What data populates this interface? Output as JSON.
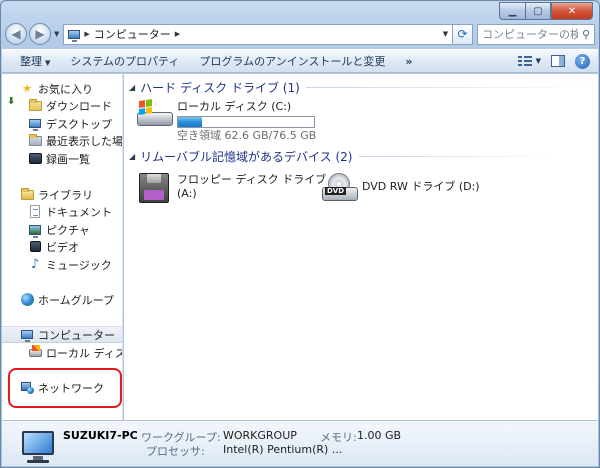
{
  "address_bar": {
    "breadcrumbs": [
      "コンピューター"
    ],
    "search_placeholder": "コンピューターの検索"
  },
  "command_bar": {
    "items": [
      "整理",
      "システムのプロパティ",
      "プログラムのアンインストールと変更"
    ],
    "more": "»"
  },
  "nav_pane": {
    "favorites": {
      "label": "お気に入り",
      "items": [
        "ダウンロード",
        "デスクトップ",
        "最近表示した場所",
        "録画一覧"
      ]
    },
    "libraries": {
      "label": "ライブラリ",
      "items": [
        "ドキュメント",
        "ピクチャ",
        "ビデオ",
        "ミュージック"
      ]
    },
    "homegroup": "ホームグループ",
    "computer": {
      "label": "コンピューター",
      "items": [
        "ローカル ディスク (C:)"
      ]
    },
    "network": "ネットワーク"
  },
  "content": {
    "hard_disks": {
      "header": "ハード ディスク ドライブ (1)",
      "drives": [
        {
          "name": "ローカル ディスク (C:)",
          "free_text": "空き領域 62.6 GB/76.5 GB",
          "used_fraction": 0.18
        }
      ]
    },
    "removable": {
      "header": "リムーバブル記憶域があるデバイス (2)",
      "drives": [
        {
          "name_line1": "フロッピー ディスク ドライブ",
          "name_line2": "(A:)"
        },
        {
          "name": "DVD RW ドライブ (D:)",
          "badge": "DVD"
        }
      ]
    }
  },
  "details": {
    "computer_name": "SUZUKI7-PC",
    "workgroup_label": "ワークグループ:",
    "workgroup_value": "WORKGROUP",
    "memory_label": "メモリ:",
    "memory_value": "1.00 GB",
    "processor_label": "プロセッサ:",
    "processor_value": "Intel(R) Pentium(R) ..."
  },
  "colors": {
    "highlight_box": "#e01b1b",
    "group_header": "#1e3287",
    "usage_bar": "#2a8fd9"
  }
}
